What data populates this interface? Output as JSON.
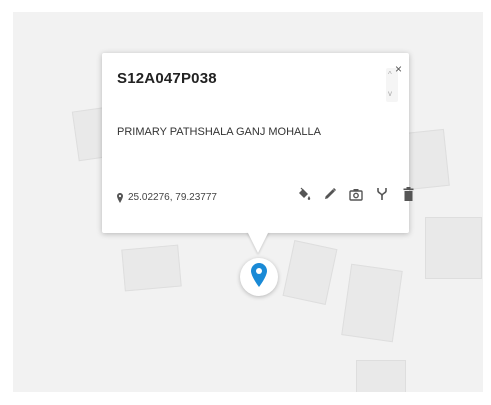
{
  "popup": {
    "title": "S12A047P038",
    "subtitle": "PRIMARY PATHSHALA GANJ MOHALLA",
    "coordinates": "25.02276, 79.23777",
    "close_label": "×",
    "scroll_up": "^",
    "scroll_down": "v",
    "actions": [
      {
        "icon": "paint-bucket-icon"
      },
      {
        "icon": "pencil-icon"
      },
      {
        "icon": "camera-icon"
      },
      {
        "icon": "fork-icon"
      },
      {
        "icon": "trash-icon"
      }
    ]
  },
  "colors": {
    "marker": "#1a8ad6",
    "map_bg": "#f2f2f2",
    "building": "#e9e9e9",
    "icon": "#555555"
  }
}
